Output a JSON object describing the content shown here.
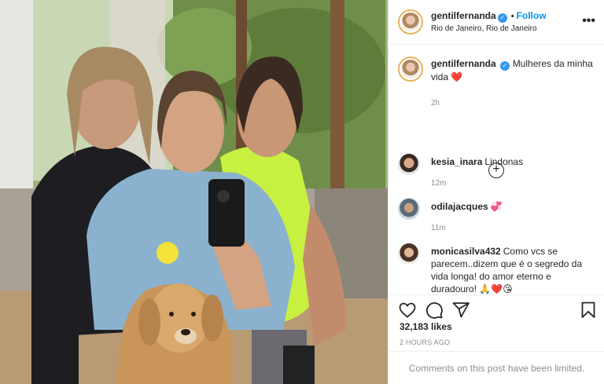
{
  "post": {
    "username": "gentilfernanda",
    "follow_label": "Follow",
    "separator": "•",
    "location": "Rio de Janeiro, Rio de Janeiro",
    "more_label": "•••",
    "verified_mark": "✓"
  },
  "caption": {
    "username": "gentilfernanda",
    "text": "Mulheres da minha vida ❤️",
    "time": "2h"
  },
  "load_more_label": "+",
  "comments": [
    {
      "username": "kesia_inara",
      "text": "Lindonas",
      "time": "12m"
    },
    {
      "username": "odilajacques",
      "text": "💞",
      "time": "11m"
    },
    {
      "username": "monicasilva432",
      "text": "Como vcs se parecem..dizem que é o segredo da vida longa! do amor eterno e duradouro! 🙏❤️😘",
      "time": ""
    }
  ],
  "actions": {
    "icons": [
      "heart-icon",
      "comment-icon",
      "share-icon",
      "bookmark-icon"
    ]
  },
  "likes": "32,183 likes",
  "time_ago": "2 HOURS AGO",
  "comments_limited": "Comments on this post have been limited.",
  "colors": {
    "accent": "#0095f6",
    "verified": "#3897f0",
    "text": "#262626",
    "muted": "#8e8e8e",
    "divider": "#efefef"
  }
}
